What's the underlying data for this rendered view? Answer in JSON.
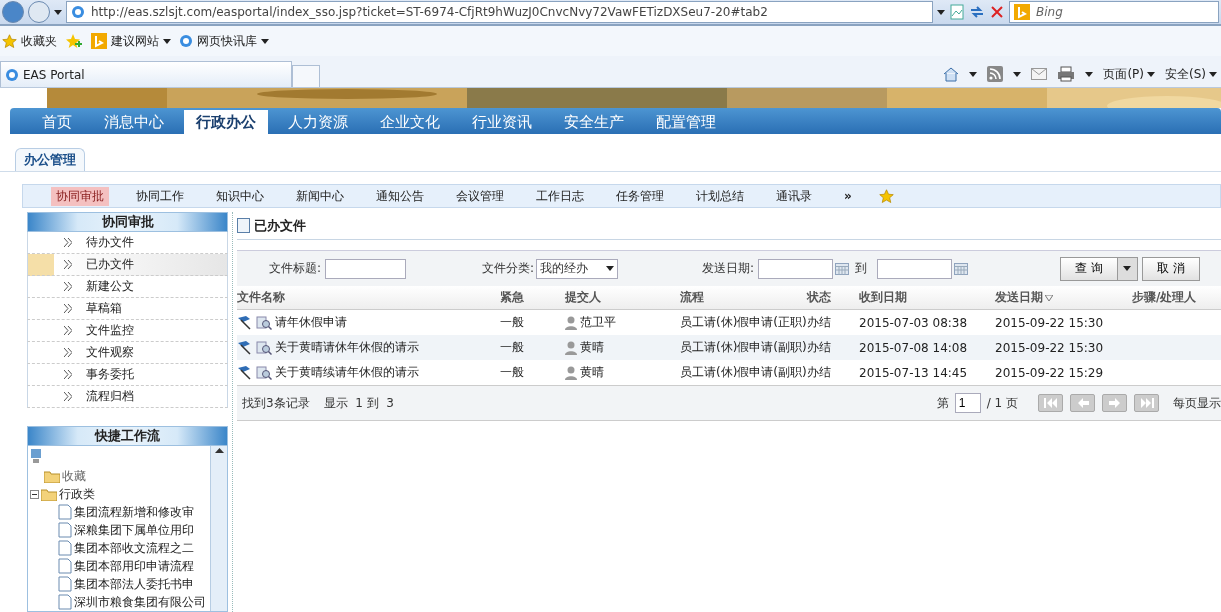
{
  "browser": {
    "address": "http://eas.szlsjt.com/easportal/index_sso.jsp?ticket=ST-6974-CfjRt9hWuzJ0CnvcNvy72VawFETizDXSeu7-20#tab2",
    "search_placeholder": "Bing",
    "favorites_label": "收藏夹",
    "favorites": [
      {
        "label": "建议网站",
        "kind": "bing"
      },
      {
        "label": "网页快讯库",
        "kind": "ie"
      }
    ],
    "tab_title": "EAS Portal",
    "commands": [
      {
        "label": "页面(P)"
      },
      {
        "label": "安全(S)"
      }
    ]
  },
  "main_nav": [
    {
      "label": "首页",
      "selected": false
    },
    {
      "label": "消息中心",
      "selected": false
    },
    {
      "label": "行政办公",
      "selected": true
    },
    {
      "label": "人力资源",
      "selected": false
    },
    {
      "label": "企业文化",
      "selected": false
    },
    {
      "label": "行业资讯",
      "selected": false
    },
    {
      "label": "安全生产",
      "selected": false
    },
    {
      "label": "配置管理",
      "selected": false
    }
  ],
  "section_title": "办公管理",
  "sub_nav": [
    {
      "label": "协同审批",
      "selected": true
    },
    {
      "label": "协同工作",
      "selected": false
    },
    {
      "label": "知识中心",
      "selected": false
    },
    {
      "label": "新闻中心",
      "selected": false
    },
    {
      "label": "通知公告",
      "selected": false
    },
    {
      "label": "会议管理",
      "selected": false
    },
    {
      "label": "工作日志",
      "selected": false
    },
    {
      "label": "任务管理",
      "selected": false
    },
    {
      "label": "计划总结",
      "selected": false
    },
    {
      "label": "通讯录",
      "selected": false
    }
  ],
  "sub_nav_more": "»",
  "sidebar": {
    "title": "协同审批",
    "items": [
      {
        "label": "待办文件",
        "selected": false
      },
      {
        "label": "已办文件",
        "selected": true
      },
      {
        "label": "新建公文",
        "selected": false
      },
      {
        "label": "草稿箱",
        "selected": false
      },
      {
        "label": "文件监控",
        "selected": false
      },
      {
        "label": "文件观察",
        "selected": false
      },
      {
        "label": "事务委托",
        "selected": false
      },
      {
        "label": "流程归档",
        "selected": false
      }
    ]
  },
  "quick_flow": {
    "title": "快捷工作流",
    "tree": [
      {
        "label": "收藏",
        "expanded": false
      },
      {
        "label": "行政类",
        "expanded": true,
        "children": [
          {
            "label": "集团流程新增和修改审"
          },
          {
            "label": "深粮集团下属单位用印"
          },
          {
            "label": "集团本部收文流程之二"
          },
          {
            "label": "集团本部用印申请流程"
          },
          {
            "label": "集团本部法人委托书申"
          },
          {
            "label": "深圳市粮食集团有限公司"
          }
        ]
      }
    ]
  },
  "panel_title": "已办文件",
  "filters": {
    "title_label": "文件标题:",
    "category_label": "文件分类:",
    "category_value": "我的经办",
    "date_label": "发送日期:",
    "date_to": "到",
    "query_button": "查 询",
    "cancel_button": "取 消"
  },
  "table": {
    "columns": [
      {
        "label": "文件名称",
        "sorted": false
      },
      {
        "label": "紧急",
        "sorted": false
      },
      {
        "label": "提交人",
        "sorted": false
      },
      {
        "label": "流程",
        "sorted": false
      },
      {
        "label": "状态",
        "sorted": false
      },
      {
        "label": "收到日期",
        "sorted": false
      },
      {
        "label": "发送日期",
        "sorted": true
      },
      {
        "label": "步骤/处理人",
        "sorted": false
      }
    ],
    "rows": [
      {
        "title": "请年休假申请",
        "urgency": "一般",
        "submitter": "范卫平",
        "flow": "员工请(休)假申请(正职)",
        "status": "办结",
        "received": "2015-07-03 08:38",
        "sent": "2015-09-22 15:30"
      },
      {
        "title": "关于黄晴请休年休假的请示",
        "urgency": "一般",
        "submitter": "黄晴",
        "flow": "员工请(休)假申请(副职)",
        "status": "办结",
        "received": "2015-07-08 14:08",
        "sent": "2015-09-22 15:30"
      },
      {
        "title": "关于黄晴续请年休假的请示",
        "urgency": "一般",
        "submitter": "黄晴",
        "flow": "员工请(休)假申请(副职)",
        "status": "办结",
        "received": "2015-07-13 14:45",
        "sent": "2015-09-22 15:29"
      }
    ]
  },
  "footer": {
    "found": "找到3条记录",
    "showing": "显示  1 到  3",
    "page_prefix": "第",
    "page_value": "1",
    "page_suffix": "/ 1 页",
    "per_page": "每页显示"
  }
}
